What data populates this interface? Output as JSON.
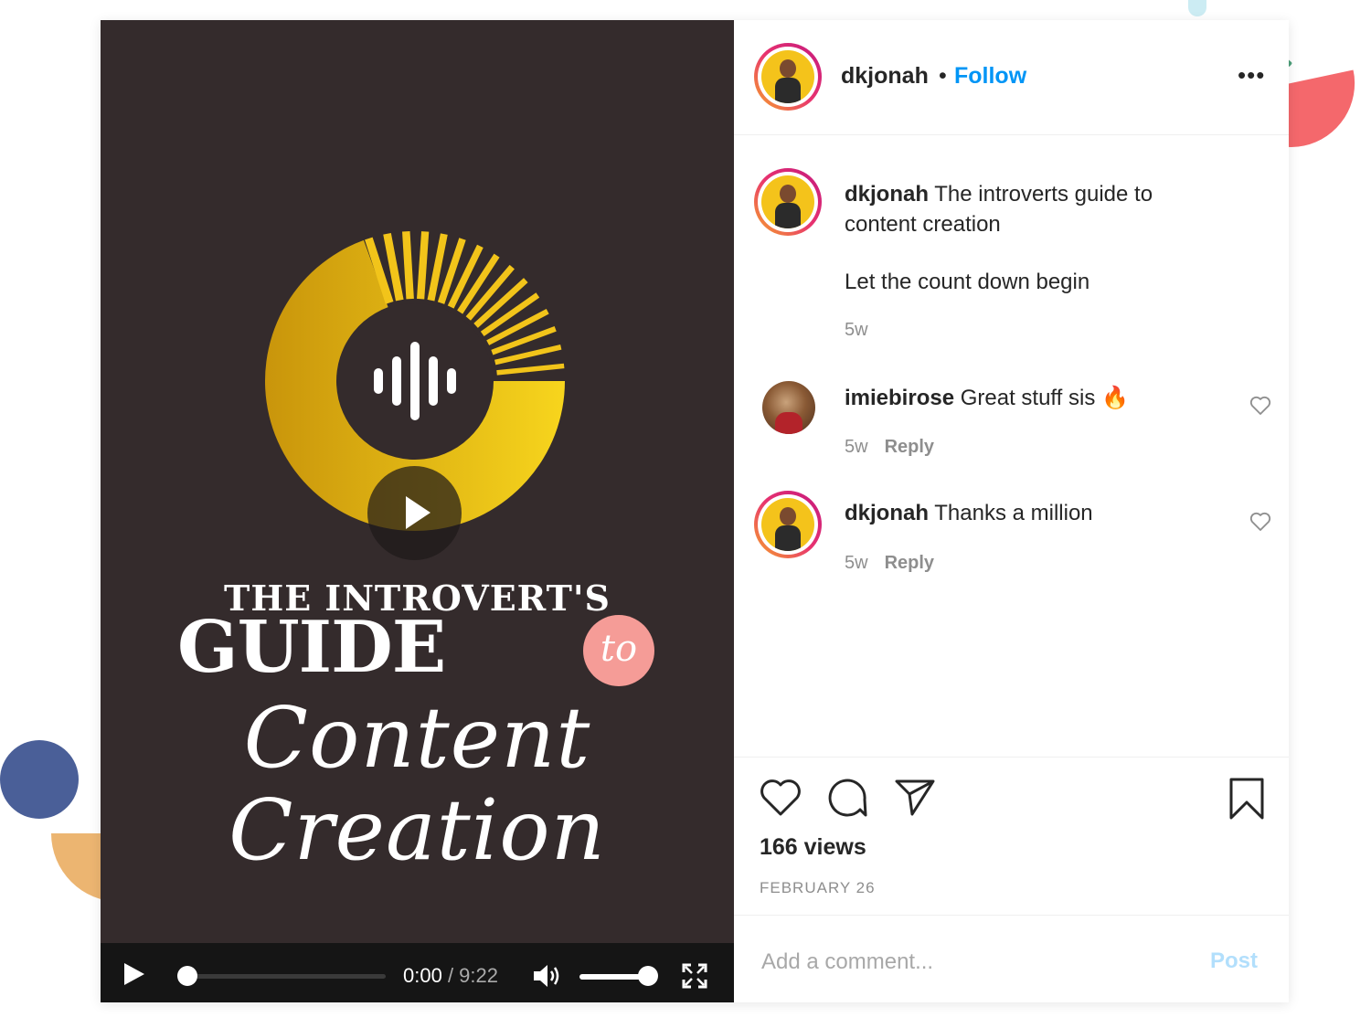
{
  "post": {
    "username": "dkjonah",
    "follow_label": "Follow",
    "separator": "•",
    "more_label": "•••"
  },
  "video": {
    "title_line1": "THE INTROVERT'S",
    "title_line2": "GUIDE",
    "title_to": "to",
    "title_line3": "Content Creation",
    "current_time": "0:00",
    "duration": "/ 9:22",
    "progress": 0,
    "volume": 1.0
  },
  "caption": {
    "username": "dkjonah",
    "text": "The introverts guide to content creation",
    "line2": "Let the count down begin",
    "time": "5w"
  },
  "comments": [
    {
      "username": "imiebirose",
      "text": "Great stuff sis 🔥",
      "time": "5w",
      "reply_label": "Reply"
    },
    {
      "username": "dkjonah",
      "text": "Thanks a million",
      "time": "5w",
      "reply_label": "Reply"
    }
  ],
  "stats": {
    "views": "166 views",
    "date": "FEBRUARY 26"
  },
  "add_comment": {
    "placeholder": "Add a comment...",
    "post_label": "Post"
  },
  "colors": {
    "accent": "#0095f6",
    "video_bg": "#342b2c",
    "logo_gold": "#f2c41a",
    "post_disabled": "#b2dffc"
  },
  "icons": [
    "heart-icon",
    "comment-icon",
    "share-icon",
    "bookmark-icon",
    "play-icon",
    "volume-icon",
    "fullscreen-icon",
    "more-icon"
  ]
}
